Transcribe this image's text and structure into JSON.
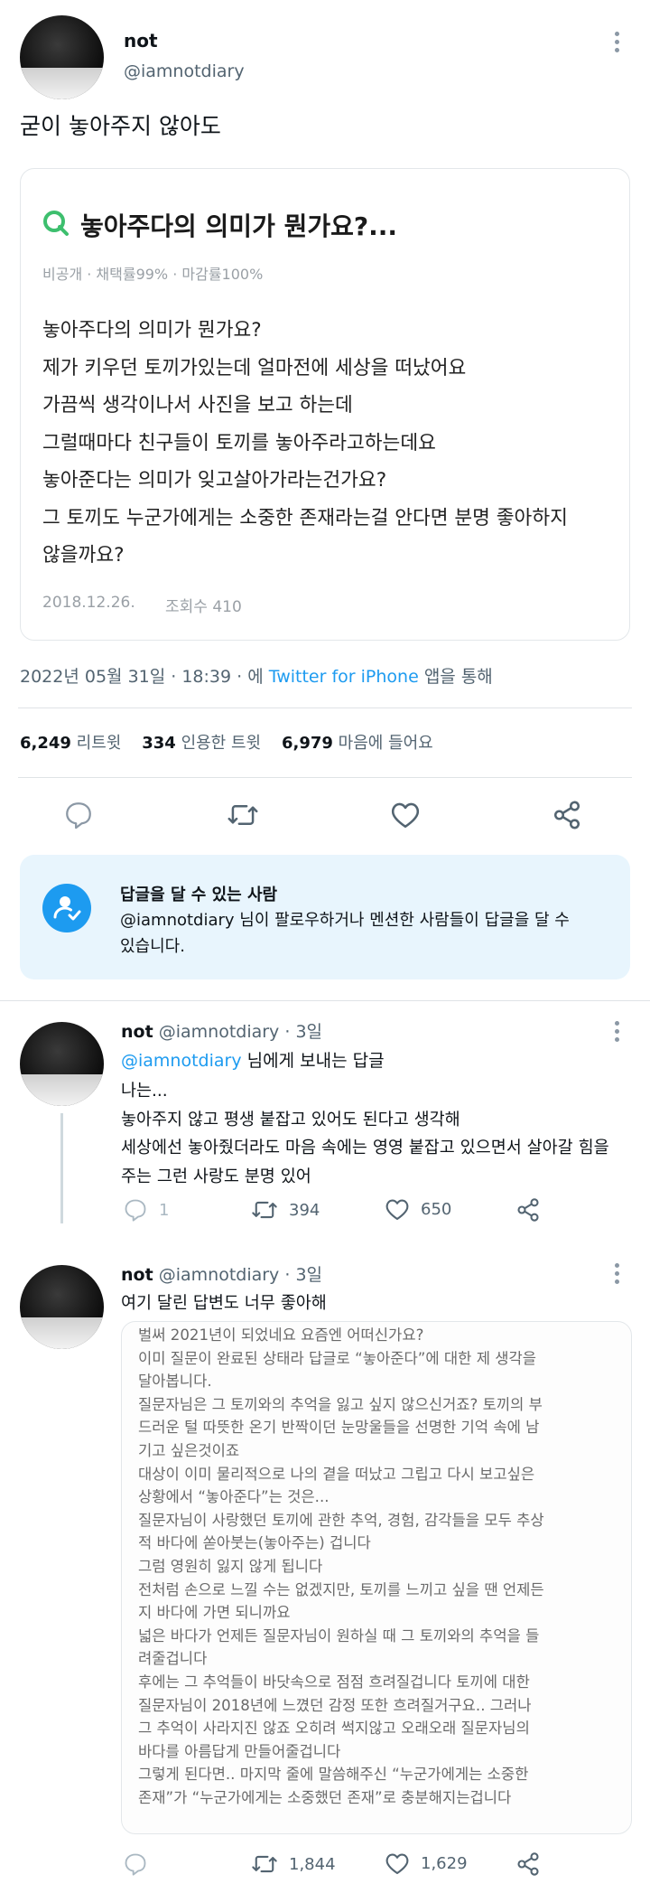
{
  "main_tweet": {
    "display_name": "not",
    "handle": "@iamnotdiary",
    "text": "굳이 놓아주지 않아도",
    "embedded_question": {
      "title": "놓아주다의 의미가 뭔가요?...",
      "meta": "비공개 · 채택률99% · 마감률100%",
      "body_lines": [
        "놓아주다의 의미가 뭔가요?",
        "제가 키우던 토끼가있는데 얼마전에 세상을 떠났어요",
        "가끔씩 생각이나서 사진을 보고 하는데",
        "그럴때마다 친구들이 토끼를 놓아주라고하는데요",
        "놓아준다는 의미가 잊고살아가라는건가요?",
        "그 토끼도 누군가에게는 소중한 존재라는걸 안다면 분명 좋아하지",
        "않을까요?"
      ],
      "date": "2018.12.26.",
      "views": "조회수 410"
    },
    "timestamp": "2022년 05월 31일 · 18:39 · 에",
    "source": "Twitter for iPhone",
    "source_suffix": "앱을 통해",
    "stats": {
      "retweets": "6,249",
      "retweets_label": "리트윗",
      "quotes": "334",
      "quotes_label": "인용한 트윗",
      "likes": "6,979",
      "likes_label": "마음에 들어요"
    }
  },
  "reply_notice": {
    "title": "답글을 달 수 있는 사람",
    "text_handle": "@iamnotdiary",
    "text_line1_rest": " 님이 팔로우하거나 멘션한 사람들이 답글을 달 수",
    "text_line2": "있습니다."
  },
  "reply1": {
    "display_name": "not",
    "handle": "@iamnotdiary",
    "time": "· 3일",
    "replying_handle": "@iamnotdiary",
    "replying_suffix": " 님에게 보내는 답글",
    "lines": [
      "나는...",
      "놓아주지 않고 평생 붙잡고 있어도 된다고 생각해",
      "세상에선 놓아줬더라도 마음 속에는 영영 붙잡고 있으면서 살아갈 힘을",
      "주는 그런 사랑도 분명 있어"
    ],
    "replies": "1",
    "retweets": "394",
    "likes": "650"
  },
  "reply2": {
    "display_name": "not",
    "handle": "@iamnotdiary",
    "time": "· 3일",
    "text": "여기 달린 답변도 너무 좋아해",
    "answer_lines": [
      "벌써 2021년이 되었네요 요즘엔 어떠신가요?",
      "이미 질문이 완료된 상태라 답글로 “놓아준다”에 대한 제 생각을",
      "달아봅니다.",
      "질문자님은 그 토끼와의 추억을 잃고 싶지 않으신거죠? 토끼의 부",
      "드러운 털 따뜻한 온기 반짝이던 눈망울들을 선명한 기억 속에 남",
      "기고 싶은것이죠",
      "대상이 이미 물리적으로 나의 곁을 떠났고 그립고 다시 보고싶은",
      "상황에서 “놓아준다”는 것은...",
      "질문자님이 사랑했던 토끼에 관한 추억, 경험, 감각들을 모두 추상",
      "적 바다에 쏟아붓는(놓아주는) 겁니다",
      "그럼 영원히 잃지 않게 됩니다",
      "전처럼 손으로 느낄 수는 없겠지만, 토끼를 느끼고 싶을 땐 언제든",
      "지 바다에 가면 되니까요",
      "넓은 바다가 언제든 질문자님이 원하실 때 그 토끼와의 추억을 들",
      "려줄겁니다",
      "후에는 그 추억들이 바닷속으로 점점 흐려질겁니다 토끼에 대한",
      "질문자님이 2018년에 느꼈던 감정 또한 흐려질거구요.. 그러나",
      "그 추억이 사라지진 않죠 오히려 썩지않고 오래오래 질문자님의",
      "바다를 아름답게 만들어줄겁니다",
      "그렇게 된다면.. 마지막 줄에 말씀해주신 “누군가에게는 소중한",
      "존재”가 “누군가에게는 소중했던 존재”로 충분해지는겁니다"
    ],
    "retweets": "1,844",
    "likes": "1,629"
  },
  "icons": [
    "reply-icon",
    "retweet-icon",
    "like-icon",
    "share-icon",
    "more-icon",
    "search-q-icon",
    "person-check-icon"
  ],
  "colors": {
    "accent": "#1d9bf0",
    "text": "#0f1419",
    "muted": "#536471",
    "notice_bg": "#e8f5fd",
    "question_green": "#3dbf6e"
  }
}
